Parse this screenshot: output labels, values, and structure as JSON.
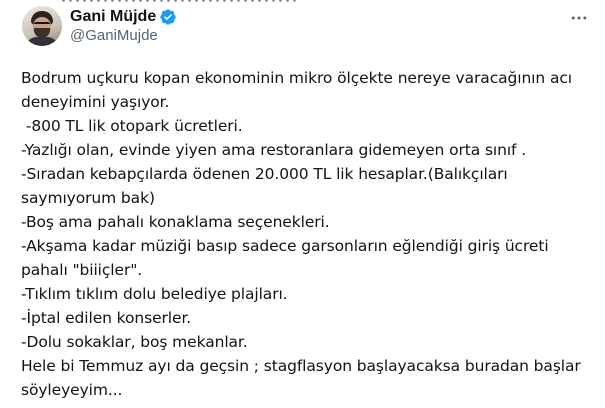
{
  "author": {
    "display_name": "Gani Müjde",
    "handle": "@GaniMujde",
    "verified": true,
    "verified_color": "#1d9bf0"
  },
  "icons": {
    "verified": "verified-badge-icon",
    "more": "more-horizontal-icon",
    "avatar": "profile-photo"
  },
  "tweet": {
    "lines": [
      "Bodrum uçkuru kopan ekonominin mikro ölçekte nereye varacağının acı",
      "deneyimini yaşıyor.",
      " -800 TL lik otopark ücretleri.",
      "-Yazlığı olan, evinde yiyen ama restoranlara gidemeyen orta sınıf .",
      "-Sıradan kebapçılarda ödenen 20.000 TL lik hesaplar.(Balıkçıları",
      "saymıyorum bak)",
      "-Boş ama pahalı konaklama seçenekleri.",
      "-Akşama kadar müziği basıp sadece garsonların eğlendiği giriş ücreti",
      "pahalı \"biiiçler\".",
      "-Tıklım tıklım dolu belediye plajları.",
      "-İptal edilen konserler.",
      "-Dolu sokaklar, boş mekanlar.",
      "Hele bi Temmuz ayı da geçsin ; stagflasyon başlayacaksa buradan başlar",
      "söyleyeyim..."
    ]
  }
}
